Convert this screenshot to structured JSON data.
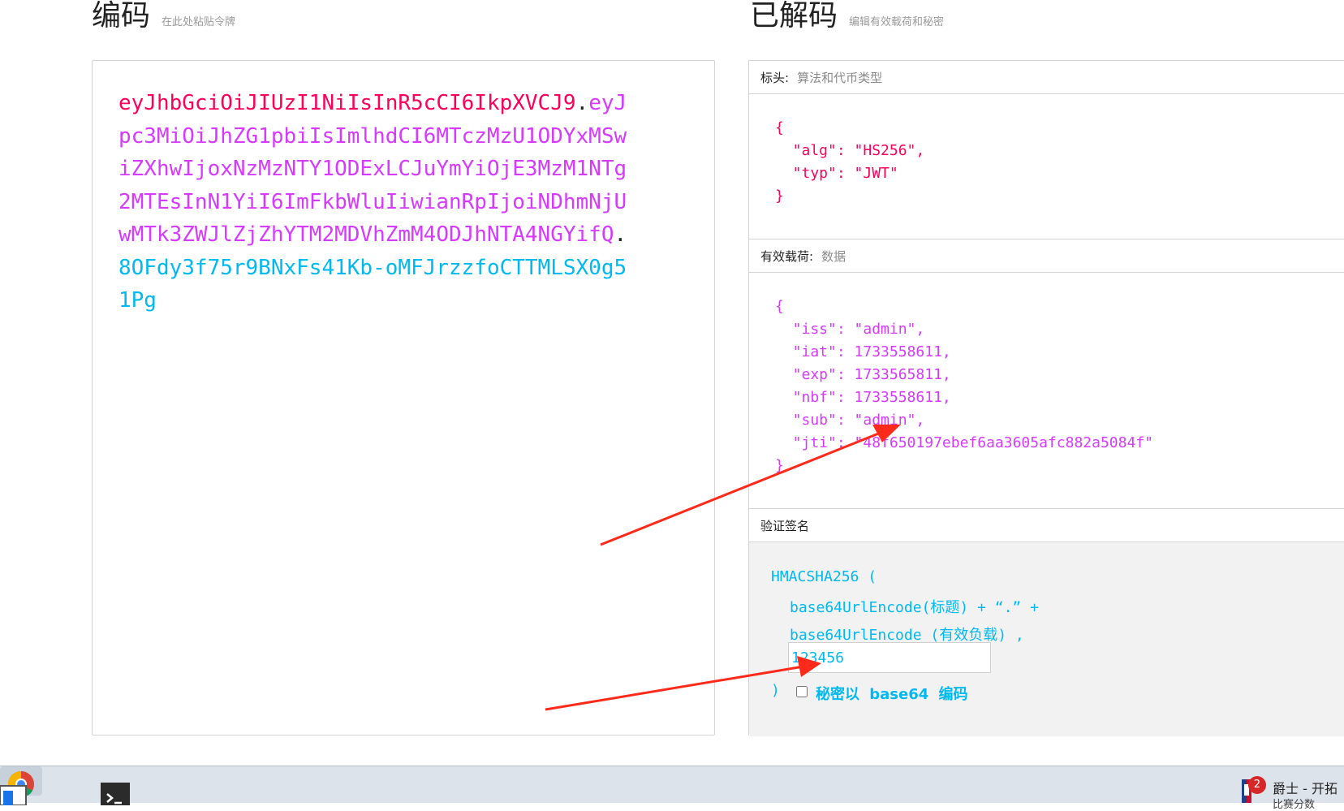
{
  "encoded": {
    "title": "编码",
    "subtitle": "在此处粘贴令牌",
    "token_header": "eyJhbGciOiJIUzI1NiIsInR5cCI6IkpXVCJ9",
    "token_payload": "eyJpc3MiOiJhZG1pbiIsImlhdCI6MTczMzU1ODYxMSwiZXhwIjoxNzMzNTY1ODExLCJuYmYiOjE3MzM1NTg2MTEsInN1YiI6ImFkbWluIiwianRpIjoiNDhmNjUwMTk3ZWJlZjZhYTM2MDVhZmM4ODJhNTA4NGYifQ",
    "token_signature": "8OFdy3f75r9BNxFs41Kb-oMFJrzzfoCTTMLSX0g51Pg",
    "dot": "."
  },
  "decoded": {
    "title": "已解码",
    "subtitle": "编辑有效载荷和秘密",
    "header_label": "标头:",
    "header_sub": "算法和代币类型",
    "header_json": "{\n  \"alg\": \"HS256\",\n  \"typ\": \"JWT\"\n}",
    "payload_label": "有效载荷:",
    "payload_sub": "数据",
    "payload_json": "{\n  \"iss\": \"admin\",\n  \"iat\": 1733558611,\n  \"exp\": 1733565811,\n  \"nbf\": 1733558611,\n  \"sub\": \"admin\",\n  \"jti\": \"48f650197ebef6aa3605afc882a5084f\"\n}",
    "signature_label": "验证签名",
    "sig_line1": "HMACSHA256 (",
    "sig_line2": "base64UrlEncode(标题) + “.” +",
    "sig_line3": "base64UrlEncode (有效负载) ,",
    "secret_value": "123456",
    "sig_close": ")",
    "b64_label": "秘密以 base64 编码",
    "b64_checked": false
  },
  "taskbar": {
    "badge_count": "2",
    "weather_text": "爵士 - 开拓",
    "weather_sub": "比赛分数"
  },
  "colors": {
    "header": "#fb015b",
    "payload": "#d63aff",
    "signature": "#00b9f1",
    "annotation_arrow": "#ff2a1a"
  }
}
